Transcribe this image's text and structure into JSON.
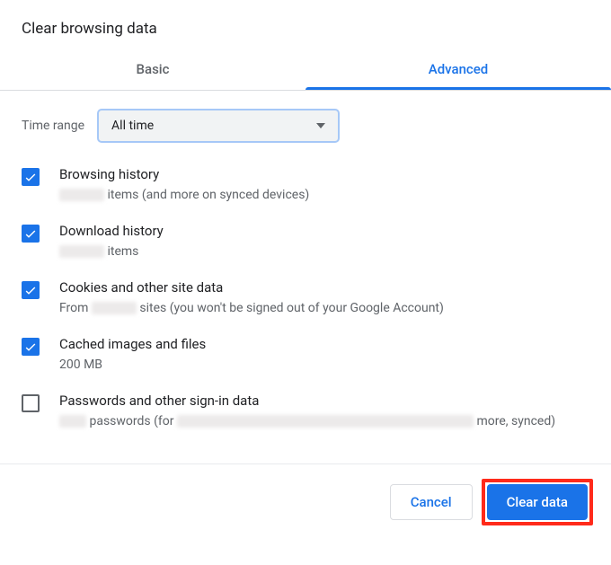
{
  "dialog": {
    "title": "Clear browsing data"
  },
  "tabs": {
    "basic": "Basic",
    "advanced": "Advanced"
  },
  "timeRange": {
    "label": "Time range",
    "value": "All time"
  },
  "options": {
    "browsing": {
      "title": "Browsing history",
      "sub_after": "items (and more on synced devices)"
    },
    "download": {
      "title": "Download history",
      "sub_after": "items"
    },
    "cookies": {
      "title": "Cookies and other site data",
      "sub_before": "From",
      "sub_after": "sites (you won't be signed out of your Google Account)"
    },
    "cached": {
      "title": "Cached images and files",
      "sub": "200 MB"
    },
    "passwords": {
      "title": "Passwords and other sign-in data",
      "sub_mid": "passwords (for",
      "sub_after": "more, synced)"
    }
  },
  "footer": {
    "cancel": "Cancel",
    "clear": "Clear data"
  }
}
